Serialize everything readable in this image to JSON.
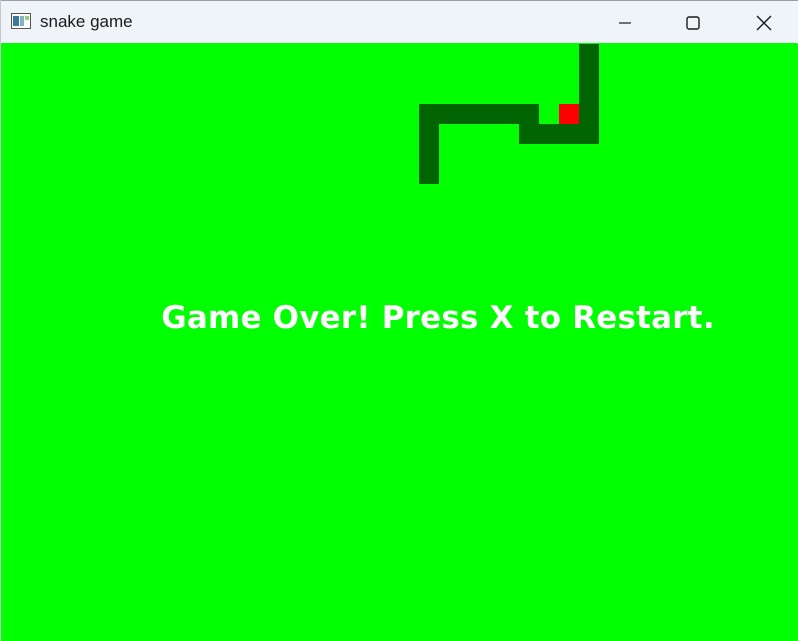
{
  "window": {
    "title": "snake game",
    "controls": {
      "minimize": "minimize-icon",
      "maximize": "maximize-icon",
      "close": "close-icon"
    }
  },
  "game": {
    "background_color": "#00ff00",
    "snake_color": "#006400",
    "food_color": "#ff0000",
    "message": "Game Over! Press X to Restart.",
    "message_color": "#ffffff"
  }
}
